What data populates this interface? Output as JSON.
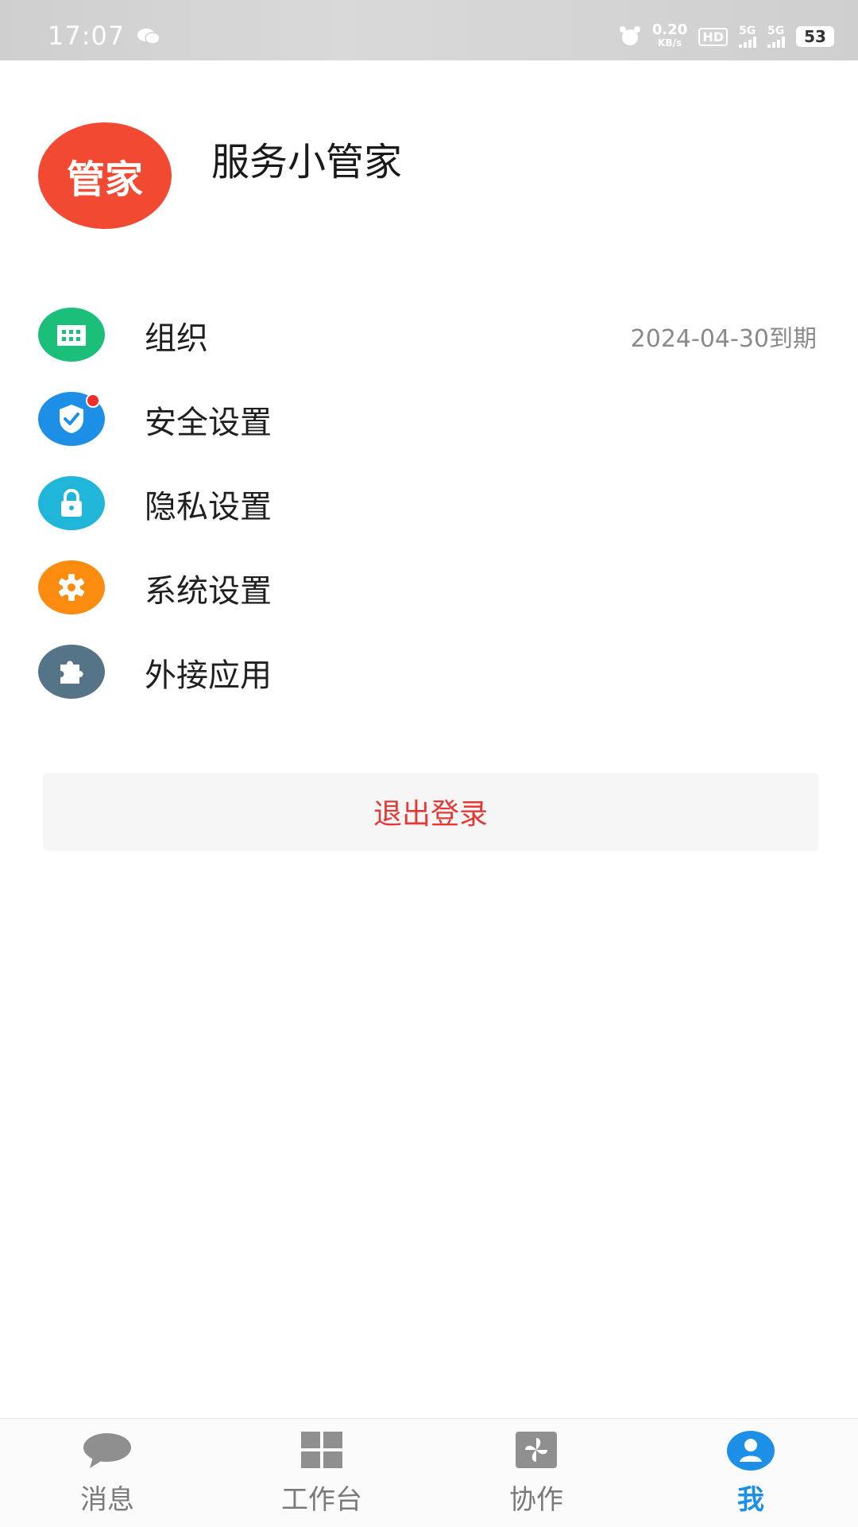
{
  "status_bar": {
    "time": "17:07",
    "net_speed": "0.20",
    "net_unit": "KB/s",
    "hd": "HD",
    "signal1": "5G",
    "signal2": "5G",
    "battery": "53"
  },
  "profile": {
    "avatar_text": "管家",
    "name": "服务小管家",
    "avatar_color": "#f24a32"
  },
  "menu": [
    {
      "label": "组织",
      "meta": "2024-04-30到期",
      "icon": "building-icon",
      "color": "#1bbf7a"
    },
    {
      "label": "安全设置",
      "meta": "",
      "icon": "shield-check-icon",
      "color": "#1e8fe6"
    },
    {
      "label": "隐私设置",
      "meta": "",
      "icon": "lock-icon",
      "color": "#1fb6d9"
    },
    {
      "label": "系统设置",
      "meta": "",
      "icon": "gear-icon",
      "color": "#fb8c0f"
    },
    {
      "label": "外接应用",
      "meta": "",
      "icon": "puzzle-icon",
      "color": "#557487"
    }
  ],
  "logout_label": "退出登录",
  "bottom_nav": [
    {
      "label": "消息",
      "icon": "chat-bubble-icon",
      "active": false
    },
    {
      "label": "工作台",
      "icon": "grid-icon",
      "active": false
    },
    {
      "label": "协作",
      "icon": "pinwheel-icon",
      "active": false
    },
    {
      "label": "我",
      "icon": "user-icon",
      "active": true
    }
  ],
  "colors": {
    "accent": "#1e8fe6",
    "danger": "#e53935"
  }
}
